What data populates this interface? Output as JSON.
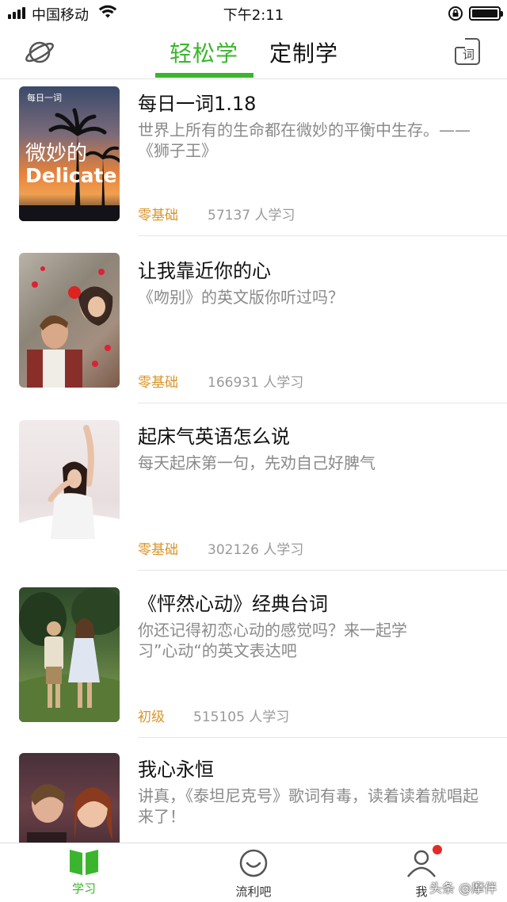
{
  "status_bar": {
    "carrier": "中国移动",
    "time": "下午2:11"
  },
  "header": {
    "tabs": [
      {
        "label": "轻松学",
        "active": true
      },
      {
        "label": "定制学",
        "active": false
      }
    ],
    "dict_icon_label": "词",
    "accent_color": "#3bb52d"
  },
  "lessons": [
    {
      "title": "每日一词1.18",
      "desc": "世界上所有的生命都在微妙的平衡中生存。——《狮子王》",
      "level": "零基础",
      "learners": "57137 人学习",
      "thumb_tag": "每日一词",
      "thumb_cn": "微妙的",
      "thumb_en": "Delicate"
    },
    {
      "title": "让我靠近你的心",
      "desc": "《吻别》的英文版你听过吗？",
      "level": "零基础",
      "learners": "166931 人学习"
    },
    {
      "title": "起床气英语怎么说",
      "desc": "每天起床第一句，先劝自己好脾气",
      "level": "零基础",
      "learners": "302126 人学习"
    },
    {
      "title": "《怦然心动》经典台词",
      "desc": "你还记得初恋心动的感觉吗？来一起学习”心动“的英文表达吧",
      "level": "初级",
      "learners": "515105 人学习"
    },
    {
      "title": "我心永恒",
      "desc": "讲真，《泰坦尼克号》歌词有毒，读着读着就唱起来了！",
      "level": "",
      "learners": ""
    }
  ],
  "tabbar": {
    "items": [
      {
        "label": "学习",
        "active": true
      },
      {
        "label": "流利吧",
        "active": false
      },
      {
        "label": "我",
        "active": false,
        "badge": true
      }
    ]
  },
  "watermark": "头条 @摩伴"
}
